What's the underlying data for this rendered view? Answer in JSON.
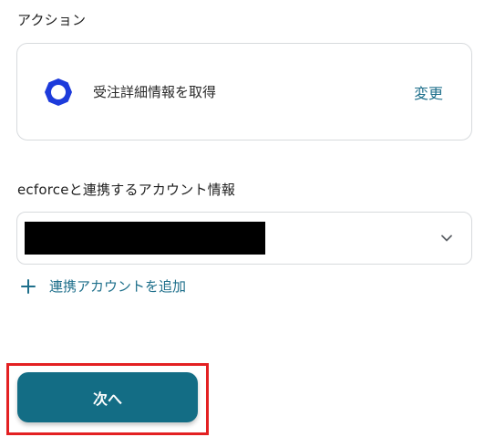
{
  "action_section": {
    "label": "アクション",
    "app_icon": "ring-icon",
    "app_icon_color": "#1d3bdb",
    "action_name": "受注詳細情報を取得",
    "change_label": "変更"
  },
  "account_section": {
    "label": "ecforceと連携するアカウント情報",
    "selected_value": "",
    "dropdown_icon": "chevron-down-icon",
    "add_account_icon": "plus-icon",
    "add_account_label": "連携アカウントを追加"
  },
  "footer": {
    "next_label": "次へ",
    "accent_color": "#136d85",
    "highlight_color": "#e32022"
  }
}
